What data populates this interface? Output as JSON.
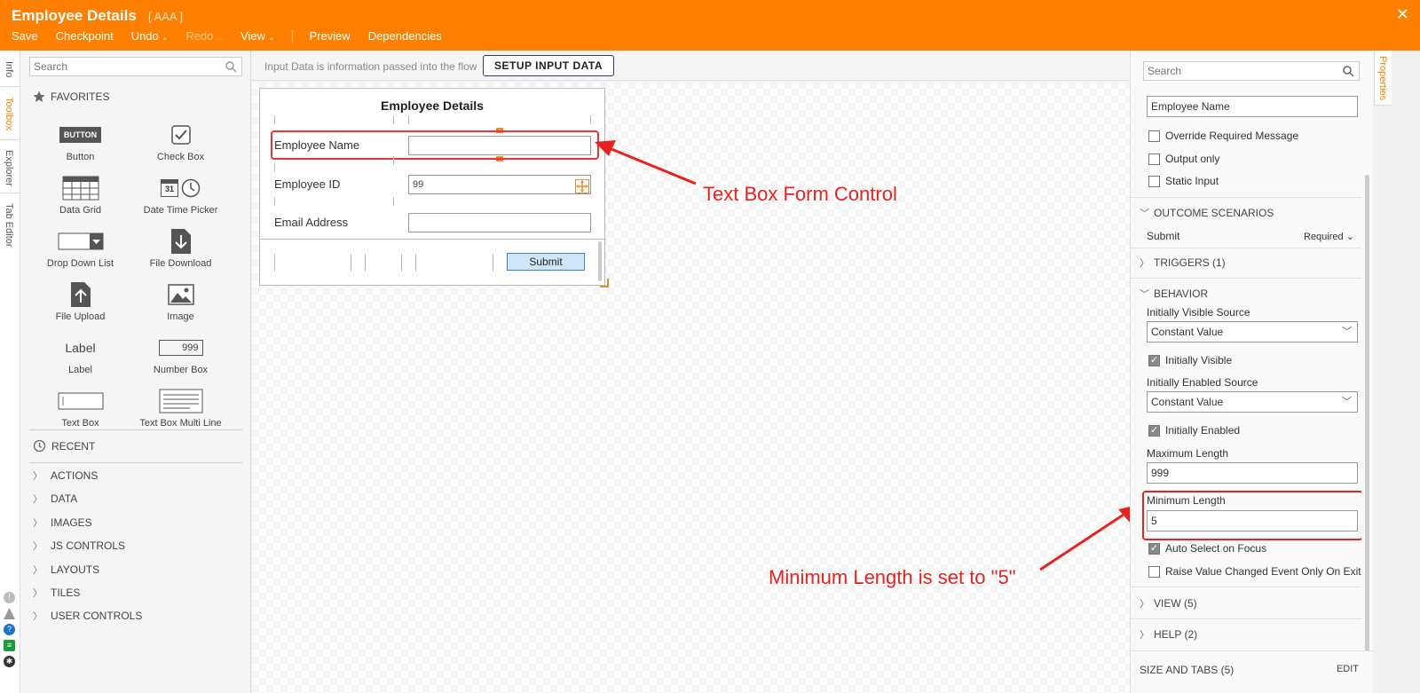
{
  "header": {
    "title": "Employee Details",
    "subtitle": "[ AAA ]",
    "menu": [
      {
        "label": "Save"
      },
      {
        "label": "Checkpoint"
      },
      {
        "label": "Undo"
      },
      {
        "label": "Redo"
      },
      {
        "label": "View"
      },
      {
        "label": "Preview"
      },
      {
        "label": "Dependencies"
      }
    ]
  },
  "left_tabs": [
    "Info",
    "Toolbox",
    "Explorer",
    "Tab Editor"
  ],
  "toolbox": {
    "search_placeholder": "Search",
    "favorites_label": "FAVORITES",
    "items": [
      {
        "label": "Button",
        "icon_text": "BUTTON"
      },
      {
        "label": "Check Box"
      },
      {
        "label": "Data Grid"
      },
      {
        "label": "Date Time Picker",
        "icon_text": "31"
      },
      {
        "label": "Drop Down List"
      },
      {
        "label": "File Download"
      },
      {
        "label": "File Upload"
      },
      {
        "label": "Image"
      },
      {
        "label": "Label",
        "icon_text": "Label"
      },
      {
        "label": "Number Box",
        "icon_text": "999"
      },
      {
        "label": "Text Box"
      },
      {
        "label": "Text Box Multi Line"
      }
    ],
    "recent_label": "RECENT",
    "categories": [
      "ACTIONS",
      "DATA",
      "IMAGES",
      "JS CONTROLS",
      "LAYOUTS",
      "TILES",
      "USER CONTROLS"
    ]
  },
  "canvas": {
    "info_text": "Input Data is information passed into the flow",
    "setup_button": "SETUP INPUT DATA",
    "form": {
      "title": "Employee Details",
      "fields": [
        {
          "label": "Employee Name",
          "value": ""
        },
        {
          "label": "Employee ID",
          "value": "99"
        },
        {
          "label": "Email Address",
          "value": ""
        }
      ],
      "submit_label": "Submit"
    },
    "annotations": {
      "textbox": "Text Box Form Control",
      "minlength": "Minimum Length is set to \"5\""
    },
    "annotation_color": "#e8231f"
  },
  "properties": {
    "tab_label": "Properties",
    "search_placeholder": "Search",
    "name_value": "Employee Name",
    "checks_top": [
      {
        "label": "Override Required Message",
        "checked": false
      },
      {
        "label": "Output only",
        "checked": false
      },
      {
        "label": "Static Input",
        "checked": false
      }
    ],
    "outcome_section": "OUTCOME SCENARIOS",
    "outcome_name": "Submit",
    "outcome_value": "Required",
    "triggers_section": "TRIGGERS (1)",
    "behavior_section": "BEHAVIOR",
    "visible_source_label": "Initially Visible Source",
    "visible_source_value": "Constant Value",
    "initially_visible_label": "Initially Visible",
    "enabled_source_label": "Initially Enabled Source",
    "enabled_source_value": "Constant Value",
    "initially_enabled_label": "Initially Enabled",
    "max_length_label": "Maximum Length",
    "max_length_value": "999",
    "min_length_label": "Minimum Length",
    "min_length_value": "5",
    "auto_select_label": "Auto Select on Focus",
    "raise_event_label": "Raise Value Changed Event Only On Exit",
    "view_section": "VIEW (5)",
    "help_section": "HELP (2)",
    "footer_left": "SIZE AND TABS (5)",
    "footer_right": "EDIT"
  },
  "colors": {
    "brand": "#ff8000",
    "annotation": "#e8231f",
    "submit_fill": "#cde6f9"
  }
}
